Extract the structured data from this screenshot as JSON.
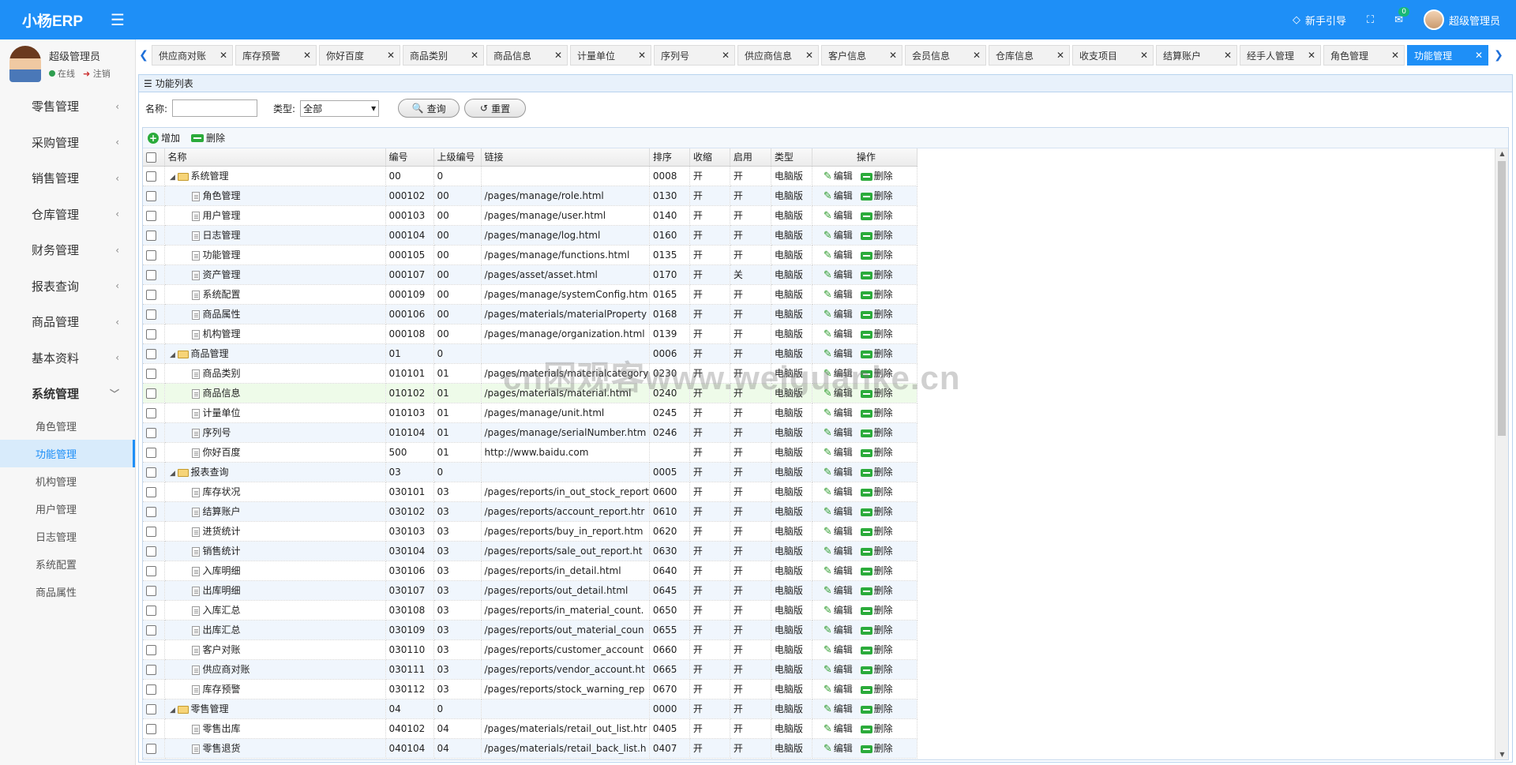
{
  "app": {
    "brand": "小杨ERP",
    "guide": "新手引导",
    "user": "超级管理员",
    "msg_count": "0"
  },
  "user_panel": {
    "name": "超级管理员",
    "status": "在线",
    "logout": "注销"
  },
  "sidebar": {
    "items": [
      {
        "label": "零售管理"
      },
      {
        "label": "采购管理"
      },
      {
        "label": "销售管理"
      },
      {
        "label": "仓库管理"
      },
      {
        "label": "财务管理"
      },
      {
        "label": "报表查询"
      },
      {
        "label": "商品管理"
      },
      {
        "label": "基本资料"
      },
      {
        "label": "系统管理"
      }
    ],
    "subitems": [
      {
        "label": "角色管理"
      },
      {
        "label": "功能管理"
      },
      {
        "label": "机构管理"
      },
      {
        "label": "用户管理"
      },
      {
        "label": "日志管理"
      },
      {
        "label": "系统配置"
      },
      {
        "label": "商品属性"
      }
    ]
  },
  "tabs": [
    {
      "label": "供应商对账"
    },
    {
      "label": "库存预警"
    },
    {
      "label": "你好百度"
    },
    {
      "label": "商品类别"
    },
    {
      "label": "商品信息"
    },
    {
      "label": "计量单位"
    },
    {
      "label": "序列号"
    },
    {
      "label": "供应商信息"
    },
    {
      "label": "客户信息"
    },
    {
      "label": "会员信息"
    },
    {
      "label": "仓库信息"
    },
    {
      "label": "收支项目"
    },
    {
      "label": "结算账户"
    },
    {
      "label": "经手人管理"
    },
    {
      "label": "角色管理"
    },
    {
      "label": "功能管理"
    }
  ],
  "panel": {
    "title": "功能列表"
  },
  "search": {
    "name_label": "名称:",
    "type_label": "类型:",
    "type_value": "全部",
    "query_btn": "查询",
    "reset_btn": "重置"
  },
  "toolbar": {
    "add": "增加",
    "delete": "删除"
  },
  "table": {
    "headers": {
      "name": "名称",
      "code": "编号",
      "parent": "上级编号",
      "url": "链接",
      "sort": "排序",
      "collapse": "收缩",
      "enabled": "启用",
      "type": "类型",
      "ops": "操作"
    },
    "edit_label": "编辑",
    "delete_label": "删除",
    "rows": [
      {
        "name": "系统管理",
        "code": "00",
        "parent": "0",
        "url": "",
        "sort": "0008",
        "collapse": "开",
        "enabled": "开",
        "type": "电脑版",
        "folder": true
      },
      {
        "name": "角色管理",
        "code": "000102",
        "parent": "00",
        "url": "/pages/manage/role.html",
        "sort": "0130",
        "collapse": "开",
        "enabled": "开",
        "type": "电脑版"
      },
      {
        "name": "用户管理",
        "code": "000103",
        "parent": "00",
        "url": "/pages/manage/user.html",
        "sort": "0140",
        "collapse": "开",
        "enabled": "开",
        "type": "电脑版"
      },
      {
        "name": "日志管理",
        "code": "000104",
        "parent": "00",
        "url": "/pages/manage/log.html",
        "sort": "0160",
        "collapse": "开",
        "enabled": "开",
        "type": "电脑版"
      },
      {
        "name": "功能管理",
        "code": "000105",
        "parent": "00",
        "url": "/pages/manage/functions.html",
        "sort": "0135",
        "collapse": "开",
        "enabled": "开",
        "type": "电脑版"
      },
      {
        "name": "资产管理",
        "code": "000107",
        "parent": "00",
        "url": "/pages/asset/asset.html",
        "sort": "0170",
        "collapse": "开",
        "enabled": "关",
        "type": "电脑版"
      },
      {
        "name": "系统配置",
        "code": "000109",
        "parent": "00",
        "url": "/pages/manage/systemConfig.htm",
        "sort": "0165",
        "collapse": "开",
        "enabled": "开",
        "type": "电脑版"
      },
      {
        "name": "商品属性",
        "code": "000106",
        "parent": "00",
        "url": "/pages/materials/materialProperty",
        "sort": "0168",
        "collapse": "开",
        "enabled": "开",
        "type": "电脑版"
      },
      {
        "name": "机构管理",
        "code": "000108",
        "parent": "00",
        "url": "/pages/manage/organization.html",
        "sort": "0139",
        "collapse": "开",
        "enabled": "开",
        "type": "电脑版"
      },
      {
        "name": "商品管理",
        "code": "01",
        "parent": "0",
        "url": "",
        "sort": "0006",
        "collapse": "开",
        "enabled": "开",
        "type": "电脑版",
        "folder": true
      },
      {
        "name": "商品类别",
        "code": "010101",
        "parent": "01",
        "url": "/pages/materials/materialcategory",
        "sort": "0230",
        "collapse": "开",
        "enabled": "开",
        "type": "电脑版"
      },
      {
        "name": "商品信息",
        "code": "010102",
        "parent": "01",
        "url": "/pages/materials/material.html",
        "sort": "0240",
        "collapse": "开",
        "enabled": "开",
        "type": "电脑版"
      },
      {
        "name": "计量单位",
        "code": "010103",
        "parent": "01",
        "url": "/pages/manage/unit.html",
        "sort": "0245",
        "collapse": "开",
        "enabled": "开",
        "type": "电脑版"
      },
      {
        "name": "序列号",
        "code": "010104",
        "parent": "01",
        "url": "/pages/manage/serialNumber.htm",
        "sort": "0246",
        "collapse": "开",
        "enabled": "开",
        "type": "电脑版"
      },
      {
        "name": "你好百度",
        "code": "500",
        "parent": "01",
        "url": "http://www.baidu.com",
        "sort": "",
        "collapse": "开",
        "enabled": "开",
        "type": "电脑版"
      },
      {
        "name": "报表查询",
        "code": "03",
        "parent": "0",
        "url": "",
        "sort": "0005",
        "collapse": "开",
        "enabled": "开",
        "type": "电脑版",
        "folder": true
      },
      {
        "name": "库存状况",
        "code": "030101",
        "parent": "03",
        "url": "/pages/reports/in_out_stock_report",
        "sort": "0600",
        "collapse": "开",
        "enabled": "开",
        "type": "电脑版"
      },
      {
        "name": "结算账户",
        "code": "030102",
        "parent": "03",
        "url": "/pages/reports/account_report.htr",
        "sort": "0610",
        "collapse": "开",
        "enabled": "开",
        "type": "电脑版"
      },
      {
        "name": "进货统计",
        "code": "030103",
        "parent": "03",
        "url": "/pages/reports/buy_in_report.htm",
        "sort": "0620",
        "collapse": "开",
        "enabled": "开",
        "type": "电脑版"
      },
      {
        "name": "销售统计",
        "code": "030104",
        "parent": "03",
        "url": "/pages/reports/sale_out_report.ht",
        "sort": "0630",
        "collapse": "开",
        "enabled": "开",
        "type": "电脑版"
      },
      {
        "name": "入库明细",
        "code": "030106",
        "parent": "03",
        "url": "/pages/reports/in_detail.html",
        "sort": "0640",
        "collapse": "开",
        "enabled": "开",
        "type": "电脑版"
      },
      {
        "name": "出库明细",
        "code": "030107",
        "parent": "03",
        "url": "/pages/reports/out_detail.html",
        "sort": "0645",
        "collapse": "开",
        "enabled": "开",
        "type": "电脑版"
      },
      {
        "name": "入库汇总",
        "code": "030108",
        "parent": "03",
        "url": "/pages/reports/in_material_count.",
        "sort": "0650",
        "collapse": "开",
        "enabled": "开",
        "type": "电脑版"
      },
      {
        "name": "出库汇总",
        "code": "030109",
        "parent": "03",
        "url": "/pages/reports/out_material_coun",
        "sort": "0655",
        "collapse": "开",
        "enabled": "开",
        "type": "电脑版"
      },
      {
        "name": "客户对账",
        "code": "030110",
        "parent": "03",
        "url": "/pages/reports/customer_account",
        "sort": "0660",
        "collapse": "开",
        "enabled": "开",
        "type": "电脑版"
      },
      {
        "name": "供应商对账",
        "code": "030111",
        "parent": "03",
        "url": "/pages/reports/vendor_account.ht",
        "sort": "0665",
        "collapse": "开",
        "enabled": "开",
        "type": "电脑版"
      },
      {
        "name": "库存预警",
        "code": "030112",
        "parent": "03",
        "url": "/pages/reports/stock_warning_rep",
        "sort": "0670",
        "collapse": "开",
        "enabled": "开",
        "type": "电脑版"
      },
      {
        "name": "零售管理",
        "code": "04",
        "parent": "0",
        "url": "",
        "sort": "0000",
        "collapse": "开",
        "enabled": "开",
        "type": "电脑版",
        "folder": true
      },
      {
        "name": "零售出库",
        "code": "040102",
        "parent": "04",
        "url": "/pages/materials/retail_out_list.htr",
        "sort": "0405",
        "collapse": "开",
        "enabled": "开",
        "type": "电脑版"
      },
      {
        "name": "零售退货",
        "code": "040104",
        "parent": "04",
        "url": "/pages/materials/retail_back_list.h",
        "sort": "0407",
        "collapse": "开",
        "enabled": "开",
        "type": "电脑版"
      }
    ]
  },
  "watermark": "cn困观客www.weiguanke.cn"
}
